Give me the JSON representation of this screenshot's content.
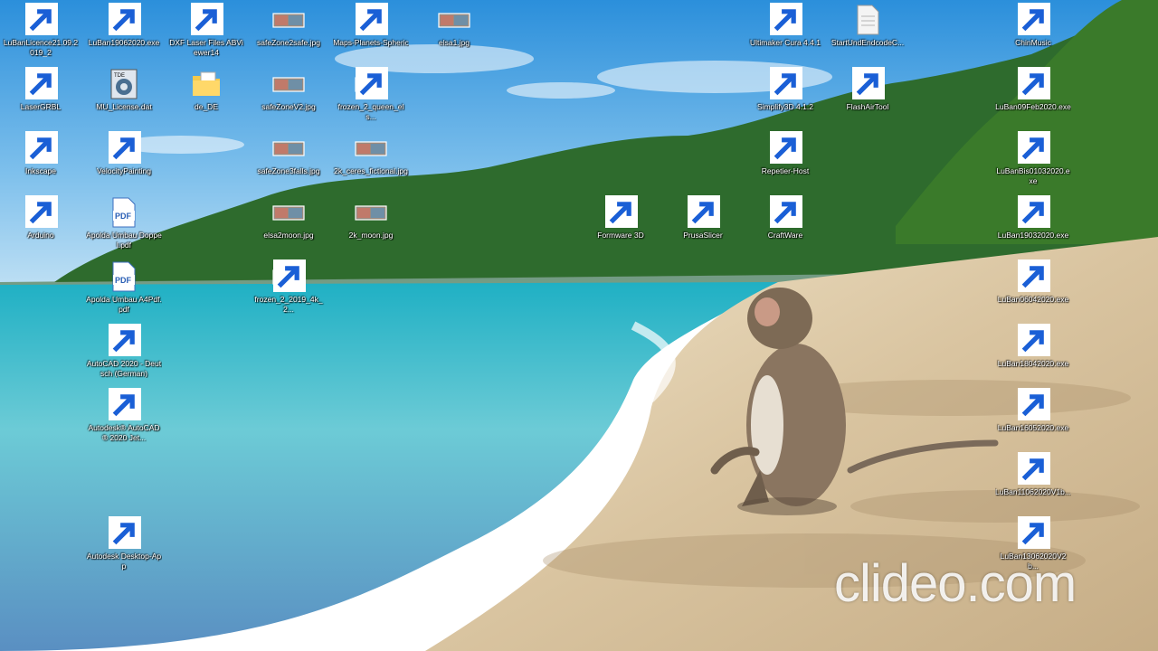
{
  "desktop": {
    "icons": [
      {
        "label": "LuBanLicence21.09.2019_2",
        "icon": "shortcut-window-icon"
      },
      {
        "label": "LuBan19062020.exe",
        "icon": "luban-icon"
      },
      {
        "label": "DXF Laser Files ABViewer14",
        "icon": "cube-icon"
      },
      {
        "label": "safeZone2safe.jpg",
        "icon": "image-thumb-icon"
      },
      {
        "label": "Maps-Planets-Spheric",
        "icon": "chrome-icon"
      },
      {
        "label": "elsa1.jpg",
        "icon": "image-thumb-icon"
      },
      {
        "label": "Ultimaker Cura 4.4.1",
        "icon": "cura-icon"
      },
      {
        "label": "StartUndEndcodeC...",
        "icon": "document-icon"
      },
      {
        "label": "ChinMusic",
        "icon": "chrome-icon"
      },
      {
        "label": "LaserGRBL",
        "icon": "grbl-icon"
      },
      {
        "label": "MU_License.dat",
        "icon": "dat-file-icon"
      },
      {
        "label": "de_DE",
        "icon": "folder-icon"
      },
      {
        "label": "safeZoneV2.jpg",
        "icon": "image-thumb-icon"
      },
      {
        "label": "frozen_2_queen_els...",
        "icon": "image-thumb-icon"
      },
      {
        "label": "Simplify3D 4.1.2",
        "icon": "simplify3d-icon"
      },
      {
        "label": "FlashAirTool",
        "icon": "flashair-icon"
      },
      {
        "label": "LuBan09Feb2020.exe",
        "icon": "luban-icon"
      },
      {
        "label": "Inkscape",
        "icon": "inkscape-icon"
      },
      {
        "label": "VelocityPainting",
        "icon": "calculator-doc-icon"
      },
      {
        "label": "safeZone3falls.jpg",
        "icon": "image-thumb-icon"
      },
      {
        "label": "2k_ceres_fictional.jpg",
        "icon": "image-thumb-icon"
      },
      {
        "label": "Repetier-Host",
        "icon": "repetier-icon"
      },
      {
        "label": "LuBanBis01032020.exe",
        "icon": "luban-icon"
      },
      {
        "label": "Arduino",
        "icon": "arduino-icon"
      },
      {
        "label": "Apolda Umbau Doppel.pdf",
        "icon": "pdf-icon"
      },
      {
        "label": "elsa2moon.jpg",
        "icon": "image-thumb-icon"
      },
      {
        "label": "2k_moon.jpg",
        "icon": "image-thumb-icon"
      },
      {
        "label": "Formware 3D",
        "icon": "formware-icon"
      },
      {
        "label": "PrusaSlicer",
        "icon": "prusaslicer-icon"
      },
      {
        "label": "CraftWare",
        "icon": "craftware-icon"
      },
      {
        "label": "LuBan19032020.exe",
        "icon": "luban-icon"
      },
      {
        "label": "Apolda Umbau A4Pdf.pdf",
        "icon": "pdf-icon"
      },
      {
        "label": "frozen_2_2019_4k_2...",
        "icon": "image-thumb-icon"
      },
      {
        "label": "LuBan06042020.exe",
        "icon": "luban-icon"
      },
      {
        "label": "AutoCAD 2020 - Deutsch (German)",
        "icon": "autocad-icon"
      },
      {
        "label": "LuBan18042020.exe",
        "icon": "luban-icon"
      },
      {
        "label": "Autodesk® AutoCAD® 2020 Jet...",
        "icon": "autocad-jet-icon"
      },
      {
        "label": "LuBan16052020.exe",
        "icon": "luban-icon"
      },
      {
        "label": "LuBan11062020V1b...",
        "icon": "luban-icon"
      },
      {
        "label": "Autodesk Desktop-App",
        "icon": "autodesk-app-icon"
      },
      {
        "label": "LuBan13062020V2b...",
        "icon": "luban-icon"
      }
    ]
  },
  "watermark": {
    "text": "clideo.com"
  },
  "colors": {
    "sky": "#3f9ee0",
    "sea": "#2fb6c9",
    "sand": "#dcc9a8",
    "forest": "#2f6a2e"
  }
}
